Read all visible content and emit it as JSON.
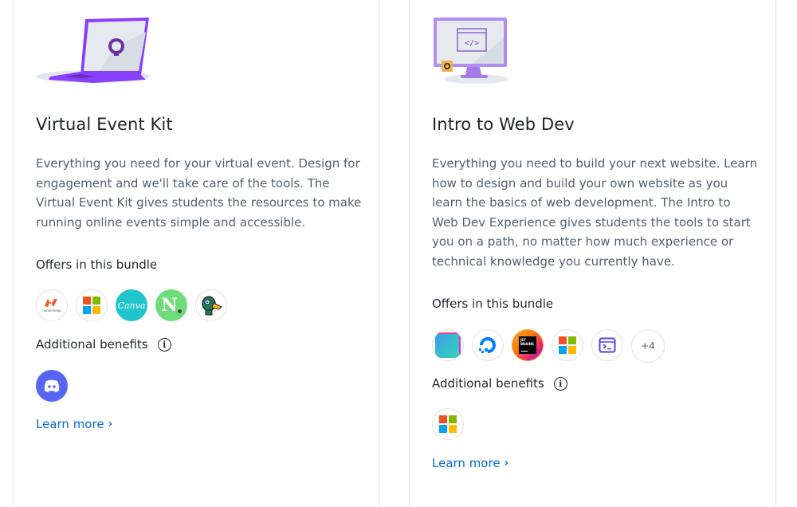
{
  "cards": [
    {
      "title": "Virtual Event Kit",
      "illustration": "laptop-github-illustration",
      "description": "Everything you need for your virtual event. Design for engagement and we'll take care of the tools. The Virtual Event Kit gives students the resources to make running online events simple and accessible.",
      "offers_label": "Offers in this bundle",
      "offers": [
        {
          "name": "namecheap",
          "icon": "namecheap-logo",
          "text": "namecheap"
        },
        {
          "name": "microsoft",
          "icon": "microsoft-logo"
        },
        {
          "name": "canva",
          "icon": "canva-logo",
          "text": "Canva"
        },
        {
          "name": "notion-like",
          "icon": "n-logo",
          "text": "N"
        },
        {
          "name": "duck",
          "icon": "duck-logo"
        }
      ],
      "benefits_label": "Additional benefits",
      "benefits": [
        {
          "name": "discord",
          "icon": "discord-logo",
          "color": "#5865F2"
        }
      ],
      "learn_more": "Learn more"
    },
    {
      "title": "Intro to Web Dev",
      "illustration": "monitor-code-illustration",
      "description": "Everything you need to build your next website. Learn how to design and build your own website as you learn the basics of web development. The Intro to Web Dev Experience gives students the tools to start you on a path, no matter how much experience or technical knowledge you currently have.",
      "offers_label": "Offers in this bundle",
      "offers": [
        {
          "name": "gradient-app",
          "icon": "gradient-square-logo"
        },
        {
          "name": "digitalocean",
          "icon": "digitalocean-logo"
        },
        {
          "name": "jetbrains",
          "icon": "jetbrains-logo",
          "text": "JET BRAINS"
        },
        {
          "name": "microsoft",
          "icon": "microsoft-logo"
        },
        {
          "name": "terminal",
          "icon": "terminal-window-logo"
        }
      ],
      "more_count": "+4",
      "benefits_label": "Additional benefits",
      "benefits": [
        {
          "name": "microsoft",
          "icon": "microsoft-logo"
        }
      ],
      "learn_more": "Learn more"
    }
  ],
  "colors": {
    "link": "#0969da",
    "illustration_purple": "#8a3ffc",
    "microsoft": [
      "#f25022",
      "#7fba00",
      "#00a4ef",
      "#ffb900"
    ]
  }
}
